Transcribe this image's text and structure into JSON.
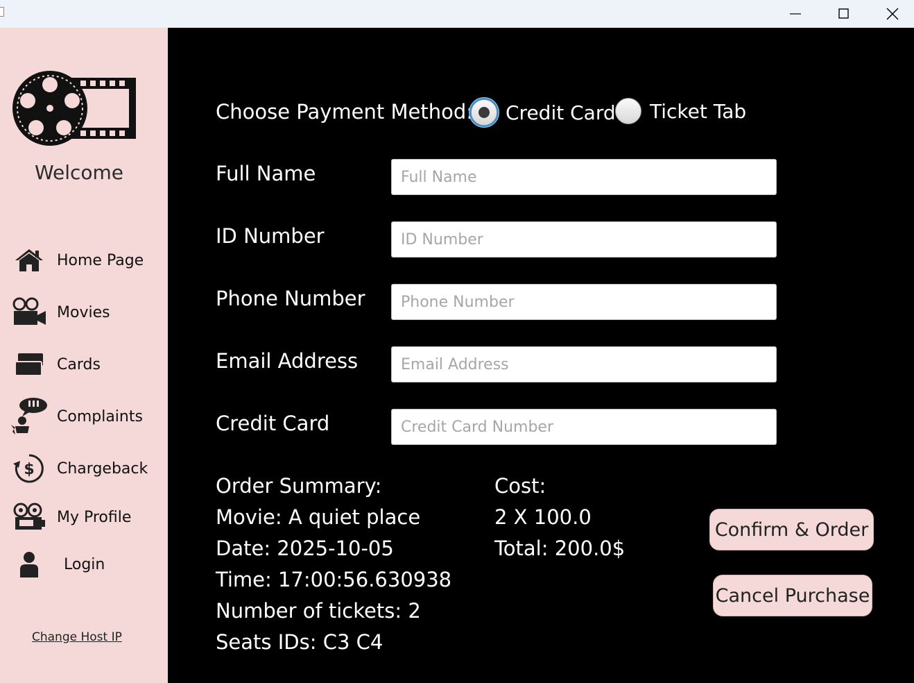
{
  "window": {
    "minimize_icon": "minimize-icon",
    "maximize_icon": "maximize-icon",
    "close_icon": "close-icon"
  },
  "sidebar": {
    "welcome": "Welcome",
    "items": [
      {
        "label": "Home Page",
        "icon": "home-icon"
      },
      {
        "label": "Movies",
        "icon": "movie-camera-icon"
      },
      {
        "label": "Cards",
        "icon": "cards-icon"
      },
      {
        "label": "Complaints",
        "icon": "complaint-icon"
      },
      {
        "label": "Chargeback",
        "icon": "chargeback-icon"
      },
      {
        "label": "My Profile",
        "icon": "projector-icon"
      },
      {
        "label": "Login",
        "icon": "user-icon"
      }
    ],
    "change_host": "Change Host IP"
  },
  "payment": {
    "label": "Choose Payment Method:",
    "options": [
      {
        "label": "Credit Card",
        "selected": true
      },
      {
        "label": "Ticket Tab",
        "selected": false
      }
    ]
  },
  "form": {
    "full_name": {
      "label": "Full Name",
      "placeholder": "Full Name",
      "value": ""
    },
    "id_number": {
      "label": "ID Number",
      "placeholder": "ID Number",
      "value": ""
    },
    "phone": {
      "label": "Phone Number",
      "placeholder": "Phone Number",
      "value": ""
    },
    "email": {
      "label": "Email Address",
      "placeholder": "Email Address",
      "value": ""
    },
    "credit_card": {
      "label": "Credit Card",
      "placeholder": "Credit Card Number",
      "value": ""
    }
  },
  "summary": {
    "title": "Order Summary:",
    "movie": "Movie: A quiet place",
    "date": "Date: 2025-10-05",
    "time": "Time: 17:00:56.630938",
    "tickets": "Number of tickets: 2",
    "seats": "Seats IDs:  C3  C4"
  },
  "cost": {
    "title": "Cost:",
    "breakdown": "2 X 100.0",
    "total": "Total: 200.0$"
  },
  "buttons": {
    "confirm": "Confirm & Order",
    "cancel": "Cancel Purchase"
  },
  "colors": {
    "sidebar_bg": "#f5d9d9",
    "main_bg": "#000000",
    "button_bg": "#f5d9d9",
    "accent": "#2a8fd6"
  }
}
